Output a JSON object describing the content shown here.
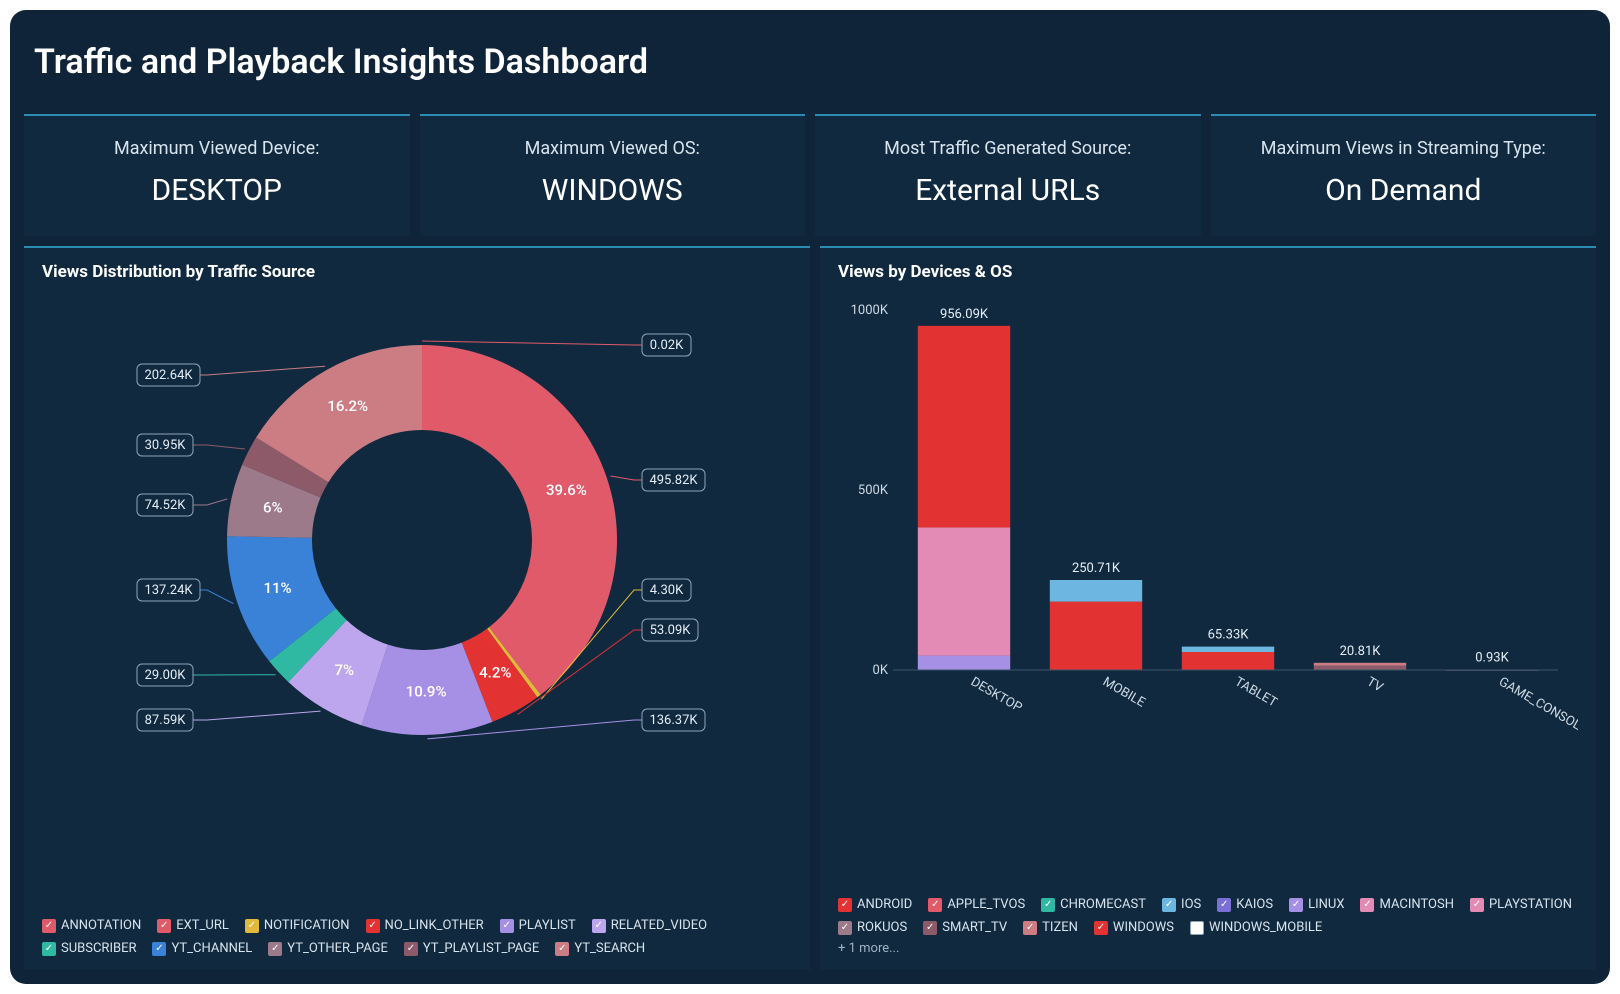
{
  "title": "Traffic and Playback Insights Dashboard",
  "kpis": [
    {
      "label": "Maximum Viewed Device:",
      "value": "DESKTOP"
    },
    {
      "label": "Maximum Viewed OS:",
      "value": "WINDOWS"
    },
    {
      "label": "Most Traffic Generated Source:",
      "value": "External URLs"
    },
    {
      "label": "Maximum Views in Streaming Type:",
      "value": "On Demand"
    }
  ],
  "panel_left_title": "Views Distribution by Traffic Source",
  "panel_right_title": "Views by Devices & OS",
  "more_text": "+ 1 more...",
  "chart_data": [
    {
      "type": "pie",
      "title": "Views Distribution by Traffic Source",
      "series_name": "Views",
      "donut": true,
      "slices": [
        {
          "name": "ANNOTATION",
          "value": 0.02,
          "value_label": "0.02K",
          "pct": 0.0016,
          "color": "#e15a6a"
        },
        {
          "name": "EXT_URL",
          "value": 495.82,
          "value_label": "495.82K",
          "pct": 39.6,
          "pct_label": "39.6%",
          "color": "#e15a6a"
        },
        {
          "name": "NOTIFICATION",
          "value": 4.3,
          "value_label": "4.30K",
          "pct": 0.34,
          "color": "#e2b93a"
        },
        {
          "name": "NO_LINK_OTHER",
          "value": 53.09,
          "value_label": "53.09K",
          "pct": 4.2,
          "pct_label": "4.2%",
          "color": "#e23232"
        },
        {
          "name": "PLAYLIST",
          "value": 136.37,
          "value_label": "136.37K",
          "pct": 10.9,
          "pct_label": "10.9%",
          "color": "#a690e6"
        },
        {
          "name": "RELATED_VIDEO",
          "value": 87.59,
          "value_label": "87.59K",
          "pct": 7.0,
          "pct_label": "7%",
          "color": "#bda6ee"
        },
        {
          "name": "SUBSCRIBER",
          "value": 29.0,
          "value_label": "29.00K",
          "pct": 2.3,
          "color": "#2fb9a3"
        },
        {
          "name": "YT_CHANNEL",
          "value": 137.24,
          "value_label": "137.24K",
          "pct": 11.0,
          "pct_label": "11%",
          "color": "#3a82d8"
        },
        {
          "name": "YT_OTHER_PAGE",
          "value": 74.52,
          "value_label": "74.52K",
          "pct": 6.0,
          "pct_label": "6%",
          "color": "#9c7a8a"
        },
        {
          "name": "YT_PLAYLIST_PAGE",
          "value": 30.95,
          "value_label": "30.95K",
          "pct": 2.5,
          "color": "#8d5a6a"
        },
        {
          "name": "YT_SEARCH",
          "value": 202.64,
          "value_label": "202.64K",
          "pct": 16.2,
          "pct_label": "16.2%",
          "color": "#cb7d83"
        }
      ],
      "legend": [
        {
          "label": "ANNOTATION",
          "color": "#e15a6a"
        },
        {
          "label": "EXT_URL",
          "color": "#e15a6a"
        },
        {
          "label": "NOTIFICATION",
          "color": "#e2b93a"
        },
        {
          "label": "NO_LINK_OTHER",
          "color": "#e23232"
        },
        {
          "label": "PLAYLIST",
          "color": "#a690e6"
        },
        {
          "label": "RELATED_VIDEO",
          "color": "#bda6ee"
        },
        {
          "label": "SUBSCRIBER",
          "color": "#2fb9a3"
        },
        {
          "label": "YT_CHANNEL",
          "color": "#3a82d8"
        },
        {
          "label": "YT_OTHER_PAGE",
          "color": "#9c7a8a"
        },
        {
          "label": "YT_PLAYLIST_PAGE",
          "color": "#8d5a6a"
        },
        {
          "label": "YT_SEARCH",
          "color": "#cb7d83"
        }
      ]
    },
    {
      "type": "bar",
      "stacked": true,
      "title": "Views by Devices & OS",
      "ylabel": "",
      "ylim": [
        0,
        1000
      ],
      "yticks": [
        0,
        500,
        1000
      ],
      "ytick_labels": [
        "0K",
        "500K",
        "1000K"
      ],
      "categories": [
        "DESKTOP",
        "MOBILE",
        "TABLET",
        "TV",
        "GAME_CONSOLE"
      ],
      "totals": [
        956.09,
        250.71,
        65.33,
        20.81,
        0.93
      ],
      "total_labels": [
        "956.09K",
        "250.71K",
        "65.33K",
        "20.81K",
        "0.93K"
      ],
      "stacks": [
        [
          {
            "os": "LINUX",
            "value": 40,
            "color": "#a690e6"
          },
          {
            "os": "MACINTOSH",
            "value": 356,
            "color": "#e48bb5"
          },
          {
            "os": "WINDOWS",
            "value": 560,
            "color": "#e23232"
          }
        ],
        [
          {
            "os": "ANDROID",
            "value": 190,
            "color": "#e23232"
          },
          {
            "os": "IOS",
            "value": 60,
            "color": "#6db6e2"
          }
        ],
        [
          {
            "os": "ANDROID",
            "value": 50,
            "color": "#e23232"
          },
          {
            "os": "IOS",
            "value": 15,
            "color": "#6db6e2"
          }
        ],
        [
          {
            "os": "SMART_TV",
            "value": 12,
            "color": "#8d5a6a"
          },
          {
            "os": "TIZEN",
            "value": 8,
            "color": "#cb7d83"
          }
        ],
        [
          {
            "os": "PLAYSTATION",
            "value": 0.93,
            "color": "#e48bb5"
          }
        ]
      ],
      "legend": [
        {
          "label": "ANDROID",
          "color": "#e23232"
        },
        {
          "label": "APPLE_TVOS",
          "color": "#e15a6a"
        },
        {
          "label": "CHROMECAST",
          "color": "#2fb9a3"
        },
        {
          "label": "IOS",
          "color": "#6db6e2"
        },
        {
          "label": "KAIOS",
          "color": "#7a6fd6"
        },
        {
          "label": "LINUX",
          "color": "#a690e6"
        },
        {
          "label": "MACINTOSH",
          "color": "#e48bb5"
        },
        {
          "label": "PLAYSTATION",
          "color": "#e48bb5"
        },
        {
          "label": "ROKUOS",
          "color": "#9c7a8a"
        },
        {
          "label": "SMART_TV",
          "color": "#8d5a6a"
        },
        {
          "label": "TIZEN",
          "color": "#cb7d83"
        },
        {
          "label": "WINDOWS",
          "color": "#e23232"
        },
        {
          "label": "WINDOWS_MOBILE",
          "color": "#ffffff"
        }
      ]
    }
  ]
}
